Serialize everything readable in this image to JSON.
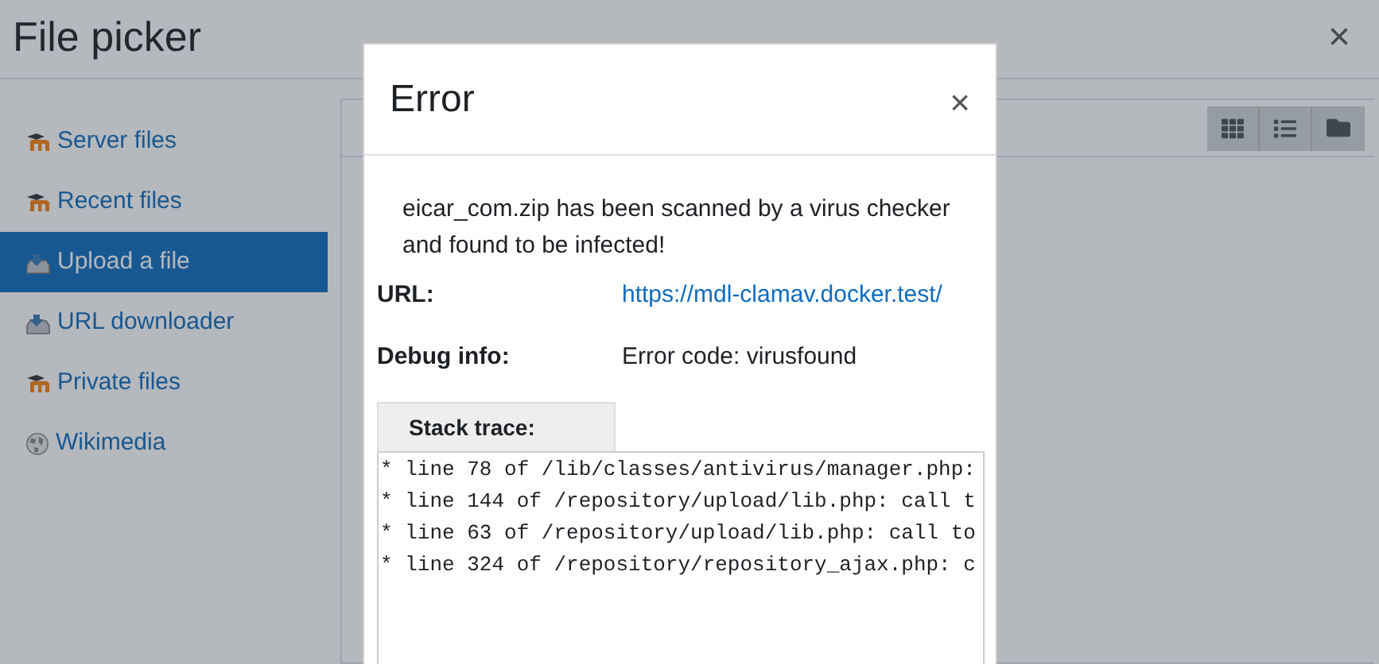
{
  "window": {
    "title": "File picker",
    "close": "×"
  },
  "sidebar": {
    "items": [
      {
        "label": "Server files",
        "kind": "moodle",
        "selected": false
      },
      {
        "label": "Recent files",
        "kind": "moodle",
        "selected": false
      },
      {
        "label": "Upload a file",
        "kind": "upload",
        "selected": true
      },
      {
        "label": "URL downloader",
        "kind": "upload",
        "selected": false
      },
      {
        "label": "Private files",
        "kind": "moodle",
        "selected": false
      },
      {
        "label": "Wikimedia",
        "kind": "globe",
        "selected": false
      }
    ]
  },
  "dialog": {
    "title": "Error",
    "close": "×",
    "message": "eicar_com.zip has been scanned by a virus checker and found to be infected!",
    "fields": [
      {
        "label": "URL:",
        "value": "https://mdl-clamav.docker.test/",
        "kind": "link"
      },
      {
        "label": "Debug info:",
        "value": "Error code: virusfound",
        "kind": "text"
      }
    ],
    "stack_trace": {
      "tab": "Stack trace:",
      "lines": [
        "* line 78 of /lib/classes/antivirus/manager.php:",
        "* line 144 of /repository/upload/lib.php: call t",
        "* line 63 of /repository/upload/lib.php: call to",
        "* line 324 of /repository/repository_ajax.php: c"
      ]
    }
  }
}
